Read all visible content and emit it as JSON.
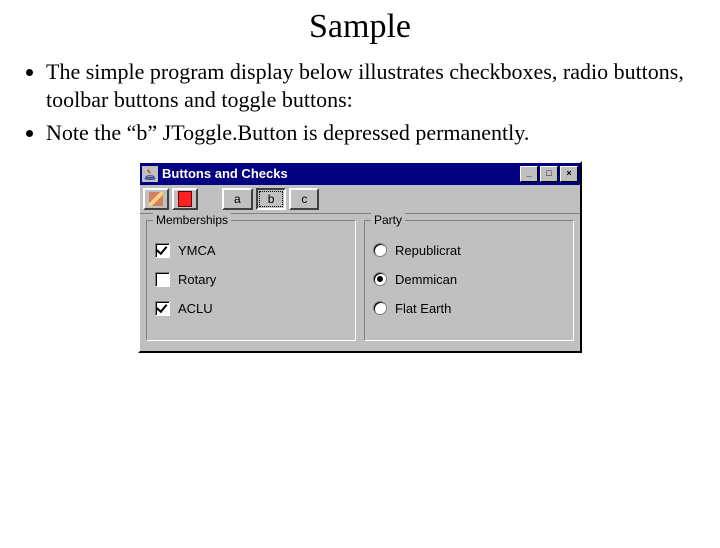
{
  "slide": {
    "title": "Sample",
    "bullet1": "The simple program display below illustrates checkboxes, radio buttons, toolbar buttons and toggle buttons:",
    "bullet2": "Note the “b” JToggle.Button is depressed permanently."
  },
  "window": {
    "title": "Buttons and Checks",
    "minimize_glyph": "_",
    "maximize_glyph": "□",
    "close_glyph": "×"
  },
  "toolbar": {
    "iconbutton1_name": "pencil-icon",
    "iconbutton2_name": "red-square-icon",
    "toggle_a": "a",
    "toggle_b": "b",
    "toggle_c": "c"
  },
  "groups": {
    "memberships": {
      "title": "Memberships",
      "items": [
        {
          "label": "YMCA",
          "checked": true
        },
        {
          "label": "Rotary",
          "checked": false
        },
        {
          "label": "ACLU",
          "checked": true
        }
      ]
    },
    "party": {
      "title": "Party",
      "items": [
        {
          "label": "Republicrat",
          "selected": false
        },
        {
          "label": "Demmican",
          "selected": true
        },
        {
          "label": "Flat Earth",
          "selected": false
        }
      ]
    }
  }
}
